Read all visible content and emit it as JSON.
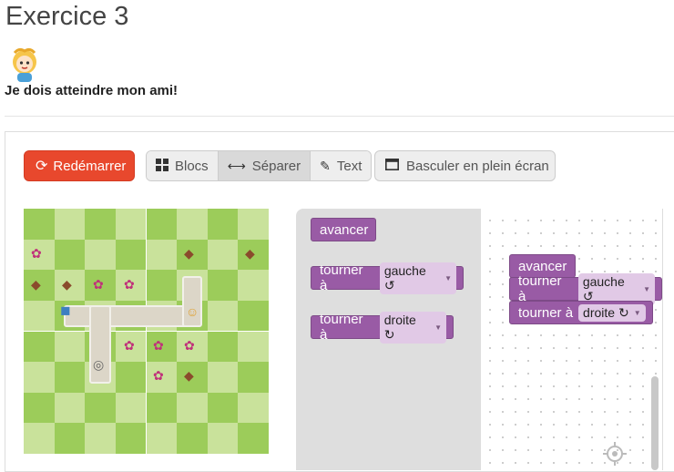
{
  "page": {
    "title": "Exercice 3",
    "subtitle": "Je dois atteindre mon ami!"
  },
  "toolbar": {
    "restart_label": "Redémarrer",
    "view_modes": [
      {
        "label": "Blocs",
        "icon": "grid-icon",
        "active": false
      },
      {
        "label": "Séparer",
        "icon": "split-arrows-icon",
        "active": true
      },
      {
        "label": "Text",
        "icon": "pencil-icon",
        "active": false
      }
    ],
    "fullscreen_label": "Basculer en plein écran"
  },
  "colors": {
    "restart": "#e8482d",
    "block": "#995ba5",
    "board_light": "#c9e29b",
    "board_dark": "#9ccc5a"
  },
  "toolbox": {
    "blocks": [
      {
        "label": "avancer"
      },
      {
        "label": "tourner à",
        "option": "gauche ↺"
      },
      {
        "label": "tourner à",
        "option": "droite ↻"
      }
    ]
  },
  "workspace": {
    "program": [
      {
        "label": "avancer"
      },
      {
        "label": "tourner à",
        "option": "gauche ↺"
      },
      {
        "label": "tourner à",
        "option": "droite ↻"
      }
    ]
  }
}
